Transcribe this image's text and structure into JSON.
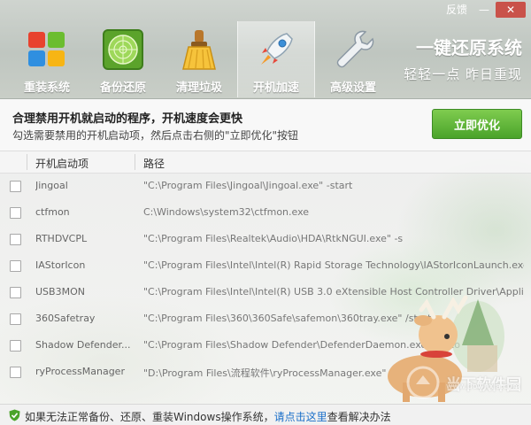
{
  "window": {
    "feedback_label": "反馈",
    "minimize_label": "—",
    "close_label": "✕"
  },
  "nav": {
    "items": [
      {
        "label": "重装系统",
        "icon": "windows-logo-icon"
      },
      {
        "label": "备份还原",
        "icon": "radar-icon"
      },
      {
        "label": "清理垃圾",
        "icon": "broom-icon"
      },
      {
        "label": "开机加速",
        "icon": "rocket-icon",
        "active": true
      },
      {
        "label": "高级设置",
        "icon": "wrench-icon"
      }
    ]
  },
  "slogan": {
    "main": "一键还原系统",
    "sub": "轻轻一点  昨日重现"
  },
  "info": {
    "title": "合理禁用开机就启动的程序，开机速度会更快",
    "description": "勾选需要禁用的开机启动项，然后点击右侧的\"立即优化\"按钮",
    "optimize_label": "立即优化"
  },
  "table": {
    "headers": {
      "name": "开机启动项",
      "path": "路径"
    },
    "rows": [
      {
        "name": "Jingoal",
        "path": "\"C:\\Program Files\\Jingoal\\Jingoal.exe\" -start"
      },
      {
        "name": "ctfmon",
        "path": "C:\\Windows\\system32\\ctfmon.exe"
      },
      {
        "name": "RTHDVCPL",
        "path": "\"C:\\Program Files\\Realtek\\Audio\\HDA\\RtkNGUI.exe\" -s"
      },
      {
        "name": "IAStorIcon",
        "path": "\"C:\\Program Files\\Intel\\Intel(R) Rapid Storage Technology\\IAStorIconLaunch.exe\" \"C:\\"
      },
      {
        "name": "USB3MON",
        "path": "\"C:\\Program Files\\Intel\\Intel(R) USB 3.0 eXtensible Host Controller Driver\\Application\\iu"
      },
      {
        "name": "360Safetray",
        "path": "\"C:\\Program Files\\360\\360Safe\\safemon\\360tray.exe\" /start"
      },
      {
        "name": "Shadow Defender...",
        "path": "\"C:\\Program Files\\Shadow Defender\\DefenderDaemon.exe\" /Auto"
      },
      {
        "name": "ryProcessManager",
        "path": "\"D:\\Program Files\\流程软件\\ryProcessManager.exe\" q"
      }
    ]
  },
  "watermark": {
    "text": "当下软件园",
    "sub": "www.downxia.com"
  },
  "footer": {
    "text_before": "如果无法正常备份、还原、重装Windows操作系统，",
    "link": "请点击这里",
    "text_after": "查看解决办法"
  },
  "colors": {
    "accent_green": "#4aa32a",
    "link_blue": "#1a6fc9",
    "close_red": "#c9524a"
  }
}
